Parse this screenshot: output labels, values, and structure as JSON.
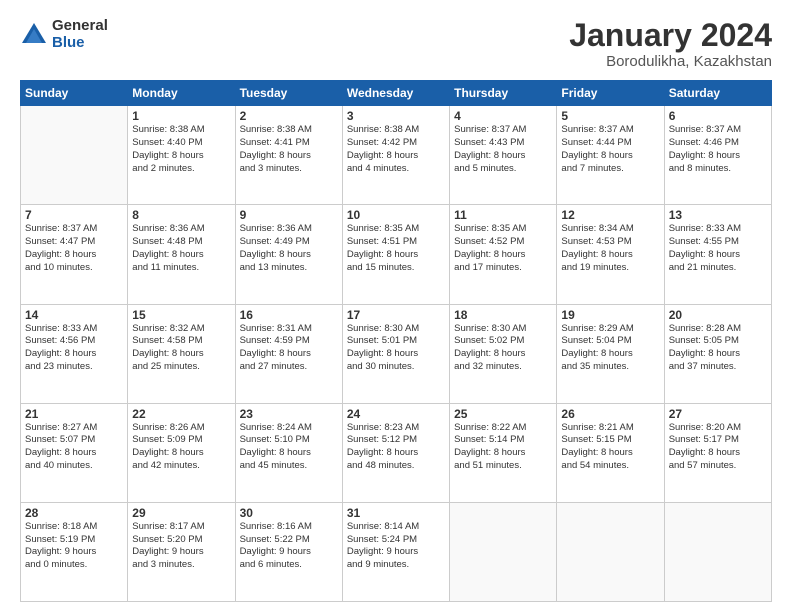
{
  "logo": {
    "general": "General",
    "blue": "Blue"
  },
  "title": "January 2024",
  "subtitle": "Borodulikha, Kazakhstan",
  "days_of_week": [
    "Sunday",
    "Monday",
    "Tuesday",
    "Wednesday",
    "Thursday",
    "Friday",
    "Saturday"
  ],
  "weeks": [
    [
      {
        "day": "",
        "info": ""
      },
      {
        "day": "1",
        "info": "Sunrise: 8:38 AM\nSunset: 4:40 PM\nDaylight: 8 hours\nand 2 minutes."
      },
      {
        "day": "2",
        "info": "Sunrise: 8:38 AM\nSunset: 4:41 PM\nDaylight: 8 hours\nand 3 minutes."
      },
      {
        "day": "3",
        "info": "Sunrise: 8:38 AM\nSunset: 4:42 PM\nDaylight: 8 hours\nand 4 minutes."
      },
      {
        "day": "4",
        "info": "Sunrise: 8:37 AM\nSunset: 4:43 PM\nDaylight: 8 hours\nand 5 minutes."
      },
      {
        "day": "5",
        "info": "Sunrise: 8:37 AM\nSunset: 4:44 PM\nDaylight: 8 hours\nand 7 minutes."
      },
      {
        "day": "6",
        "info": "Sunrise: 8:37 AM\nSunset: 4:46 PM\nDaylight: 8 hours\nand 8 minutes."
      }
    ],
    [
      {
        "day": "7",
        "info": "Sunrise: 8:37 AM\nSunset: 4:47 PM\nDaylight: 8 hours\nand 10 minutes."
      },
      {
        "day": "8",
        "info": "Sunrise: 8:36 AM\nSunset: 4:48 PM\nDaylight: 8 hours\nand 11 minutes."
      },
      {
        "day": "9",
        "info": "Sunrise: 8:36 AM\nSunset: 4:49 PM\nDaylight: 8 hours\nand 13 minutes."
      },
      {
        "day": "10",
        "info": "Sunrise: 8:35 AM\nSunset: 4:51 PM\nDaylight: 8 hours\nand 15 minutes."
      },
      {
        "day": "11",
        "info": "Sunrise: 8:35 AM\nSunset: 4:52 PM\nDaylight: 8 hours\nand 17 minutes."
      },
      {
        "day": "12",
        "info": "Sunrise: 8:34 AM\nSunset: 4:53 PM\nDaylight: 8 hours\nand 19 minutes."
      },
      {
        "day": "13",
        "info": "Sunrise: 8:33 AM\nSunset: 4:55 PM\nDaylight: 8 hours\nand 21 minutes."
      }
    ],
    [
      {
        "day": "14",
        "info": "Sunrise: 8:33 AM\nSunset: 4:56 PM\nDaylight: 8 hours\nand 23 minutes."
      },
      {
        "day": "15",
        "info": "Sunrise: 8:32 AM\nSunset: 4:58 PM\nDaylight: 8 hours\nand 25 minutes."
      },
      {
        "day": "16",
        "info": "Sunrise: 8:31 AM\nSunset: 4:59 PM\nDaylight: 8 hours\nand 27 minutes."
      },
      {
        "day": "17",
        "info": "Sunrise: 8:30 AM\nSunset: 5:01 PM\nDaylight: 8 hours\nand 30 minutes."
      },
      {
        "day": "18",
        "info": "Sunrise: 8:30 AM\nSunset: 5:02 PM\nDaylight: 8 hours\nand 32 minutes."
      },
      {
        "day": "19",
        "info": "Sunrise: 8:29 AM\nSunset: 5:04 PM\nDaylight: 8 hours\nand 35 minutes."
      },
      {
        "day": "20",
        "info": "Sunrise: 8:28 AM\nSunset: 5:05 PM\nDaylight: 8 hours\nand 37 minutes."
      }
    ],
    [
      {
        "day": "21",
        "info": "Sunrise: 8:27 AM\nSunset: 5:07 PM\nDaylight: 8 hours\nand 40 minutes."
      },
      {
        "day": "22",
        "info": "Sunrise: 8:26 AM\nSunset: 5:09 PM\nDaylight: 8 hours\nand 42 minutes."
      },
      {
        "day": "23",
        "info": "Sunrise: 8:24 AM\nSunset: 5:10 PM\nDaylight: 8 hours\nand 45 minutes."
      },
      {
        "day": "24",
        "info": "Sunrise: 8:23 AM\nSunset: 5:12 PM\nDaylight: 8 hours\nand 48 minutes."
      },
      {
        "day": "25",
        "info": "Sunrise: 8:22 AM\nSunset: 5:14 PM\nDaylight: 8 hours\nand 51 minutes."
      },
      {
        "day": "26",
        "info": "Sunrise: 8:21 AM\nSunset: 5:15 PM\nDaylight: 8 hours\nand 54 minutes."
      },
      {
        "day": "27",
        "info": "Sunrise: 8:20 AM\nSunset: 5:17 PM\nDaylight: 8 hours\nand 57 minutes."
      }
    ],
    [
      {
        "day": "28",
        "info": "Sunrise: 8:18 AM\nSunset: 5:19 PM\nDaylight: 9 hours\nand 0 minutes."
      },
      {
        "day": "29",
        "info": "Sunrise: 8:17 AM\nSunset: 5:20 PM\nDaylight: 9 hours\nand 3 minutes."
      },
      {
        "day": "30",
        "info": "Sunrise: 8:16 AM\nSunset: 5:22 PM\nDaylight: 9 hours\nand 6 minutes."
      },
      {
        "day": "31",
        "info": "Sunrise: 8:14 AM\nSunset: 5:24 PM\nDaylight: 9 hours\nand 9 minutes."
      },
      {
        "day": "",
        "info": ""
      },
      {
        "day": "",
        "info": ""
      },
      {
        "day": "",
        "info": ""
      }
    ]
  ]
}
